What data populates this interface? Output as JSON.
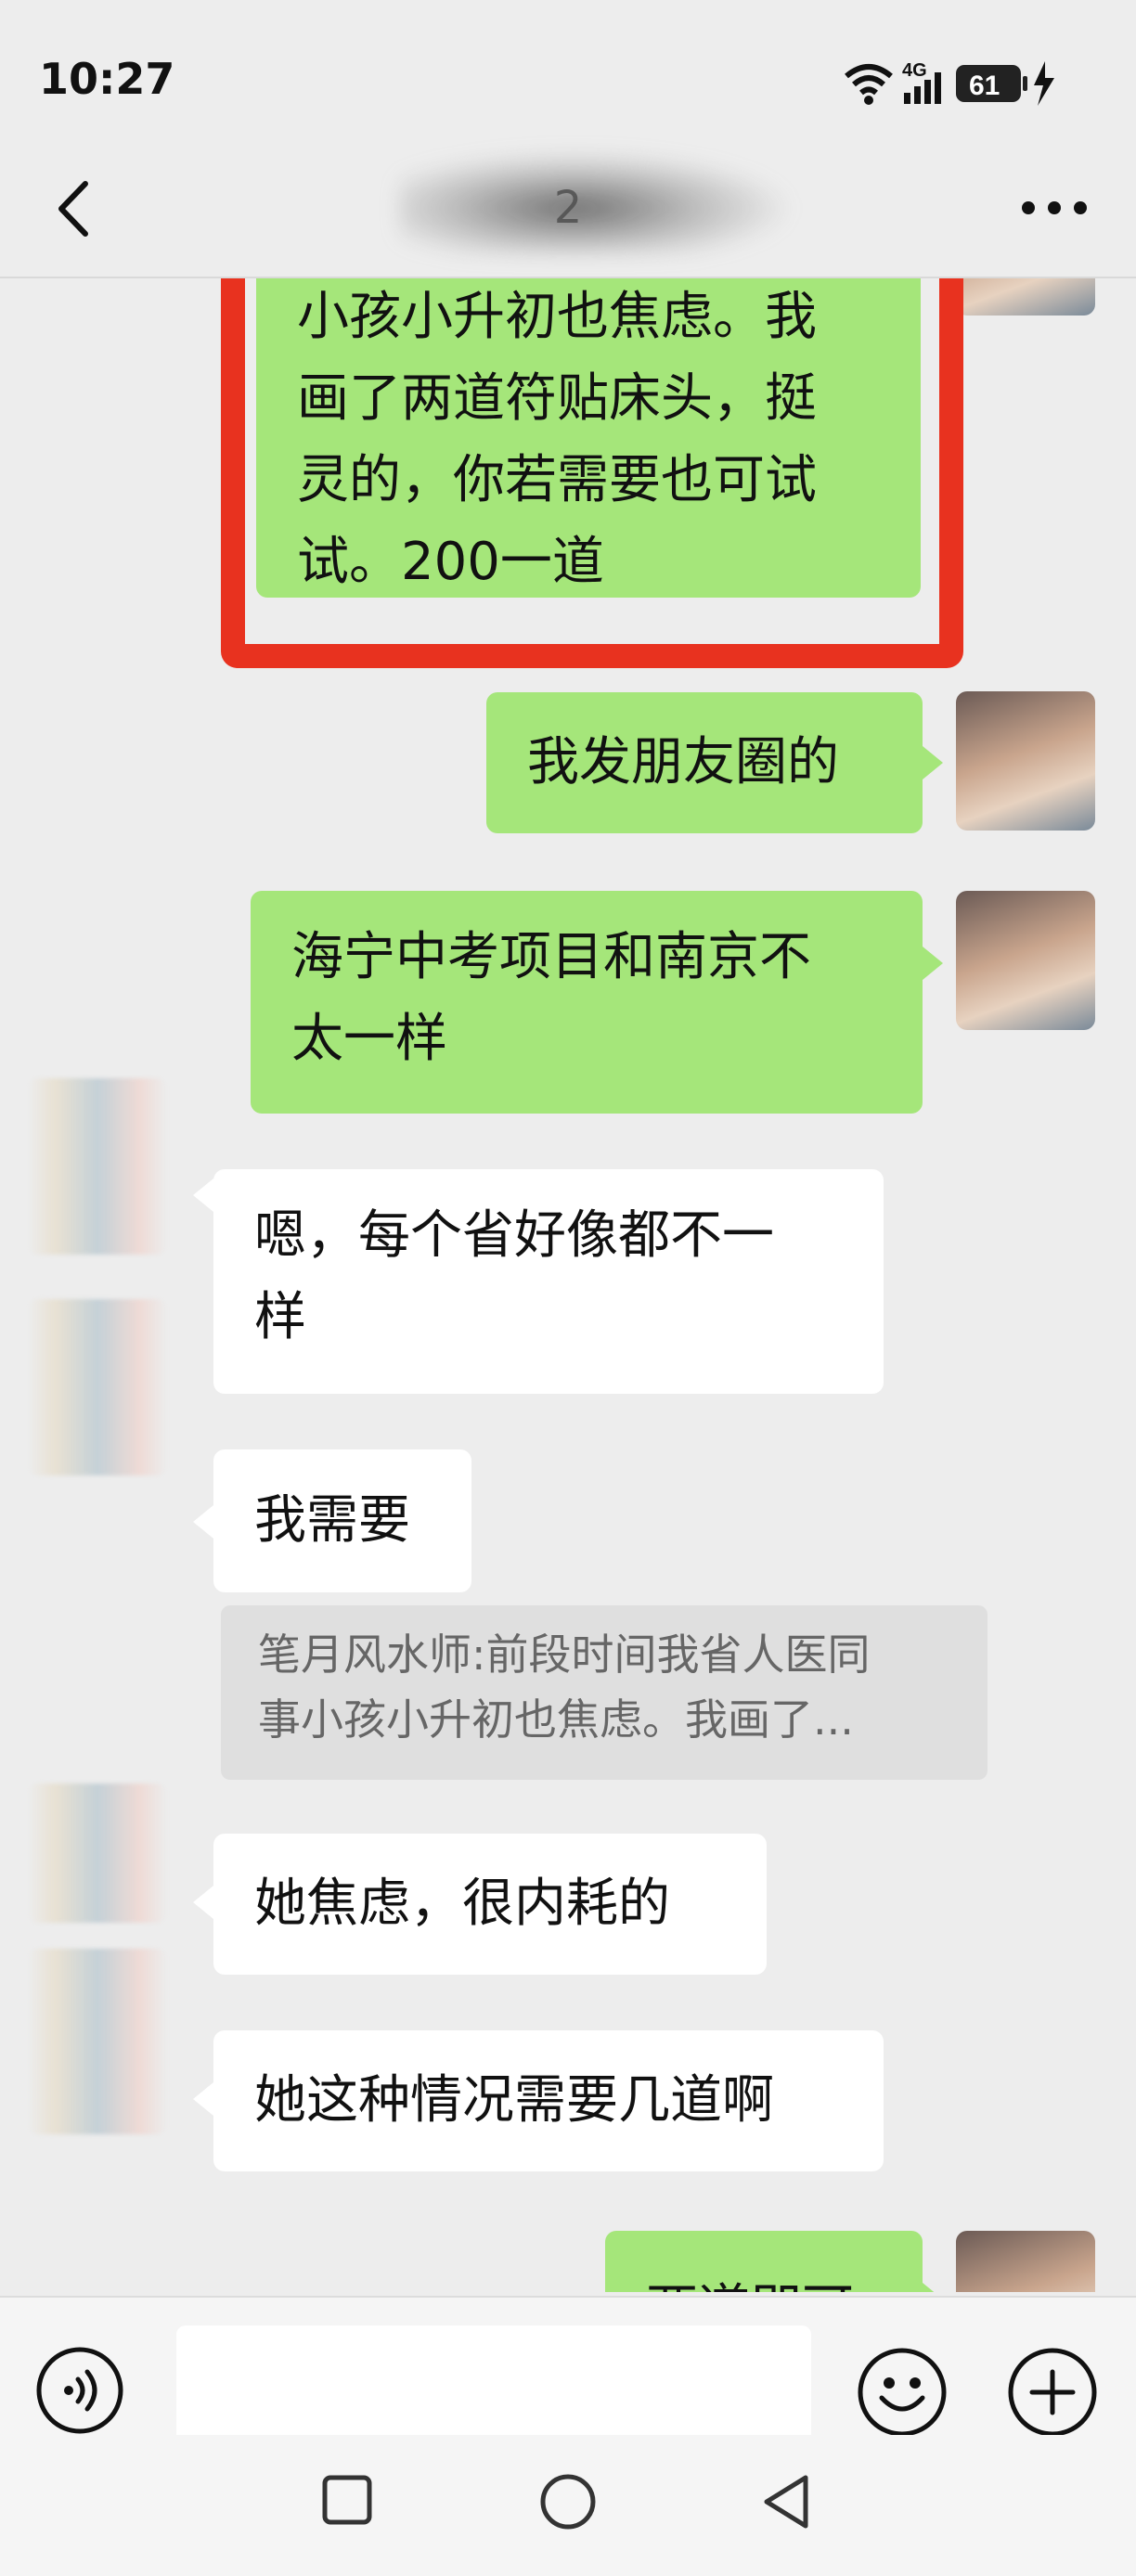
{
  "status": {
    "time": "10:27",
    "network": "4G",
    "battery": "61"
  },
  "header": {
    "title": "2"
  },
  "messages": {
    "m1": {
      "line1": "小孩小升初也焦虑。我",
      "line2": "画了两道符贴床头，挺",
      "line3": "灵的，你若需要也可试",
      "line4": "试。200一道"
    },
    "m2": {
      "text": "我发朋友圈的"
    },
    "m3": {
      "line1": "海宁中考项目和南京不",
      "line2": "太一样"
    },
    "m4": {
      "line1": "嗯，每个省好像都不一",
      "line2": "样"
    },
    "m5": {
      "text": "我需要"
    },
    "quote": {
      "line1": "笔月风水师:前段时间我省人医同",
      "line2": "事小孩小升初也焦虑。我画了..."
    },
    "m6": {
      "text": "她焦虑，很内耗的"
    },
    "m7": {
      "text": "她这种情况需要几道啊"
    },
    "m8": {
      "text": "两道即可"
    }
  },
  "colors": {
    "my_bubble": "#a5e67a",
    "their_bubble": "#ffffff",
    "highlight_border": "#e8321f",
    "background": "#ededed"
  },
  "icons": [
    "back-icon",
    "more-icon",
    "voice-icon",
    "emoji-icon",
    "plus-icon",
    "wifi-icon",
    "signal-icon",
    "battery-icon",
    "charging-icon"
  ]
}
